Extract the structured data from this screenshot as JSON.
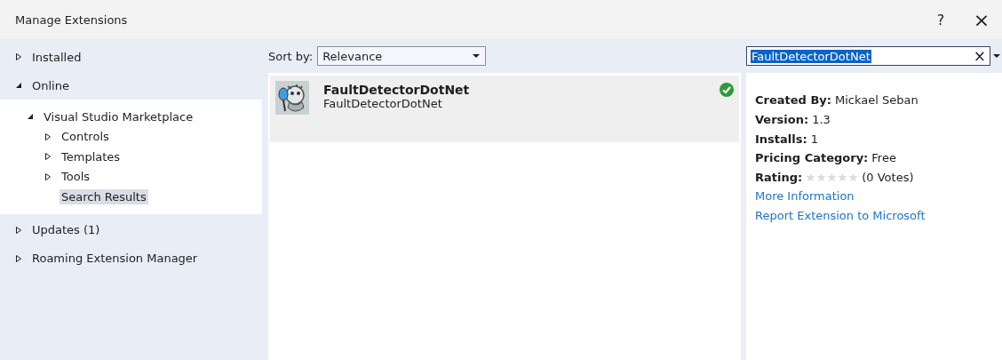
{
  "window": {
    "title": "Manage Extensions",
    "help": "?",
    "close": "×"
  },
  "sidebar": {
    "items": [
      {
        "label": "Installed",
        "expanded": false,
        "selected": false
      },
      {
        "label": "Online",
        "expanded": true,
        "selected": false,
        "children": [
          {
            "label": "Visual Studio Marketplace",
            "expanded": true,
            "selected": false,
            "children": [
              {
                "label": "Controls",
                "expanded": false,
                "selected": false
              },
              {
                "label": "Templates",
                "expanded": false,
                "selected": false
              },
              {
                "label": "Tools",
                "expanded": false,
                "selected": false
              },
              {
                "label": "Search Results",
                "selected": true
              }
            ]
          }
        ]
      },
      {
        "label": "Updates (1)",
        "expanded": false,
        "selected": false
      },
      {
        "label": "Roaming Extension Manager",
        "expanded": false,
        "selected": false
      }
    ]
  },
  "sort": {
    "label": "Sort by:",
    "value": "Relevance"
  },
  "search": {
    "value": "FaultDetectorDotNet",
    "clear": "×"
  },
  "extensions": [
    {
      "name": "FaultDetectorDotNet",
      "description": "FaultDetectorDotNet",
      "installed": true,
      "selected": true
    }
  ],
  "details": {
    "fields": [
      {
        "label": "Created By:",
        "value": "Mickael Seban"
      },
      {
        "label": "Version:",
        "value": "1.3"
      },
      {
        "label": "Installs:",
        "value": "1"
      },
      {
        "label": "Pricing Category:",
        "value": "Free"
      }
    ],
    "rating": {
      "label": "Rating:",
      "stars": 0,
      "votes": "(0 Votes)"
    },
    "links": [
      "More Information",
      "Report Extension to Microsoft"
    ]
  }
}
